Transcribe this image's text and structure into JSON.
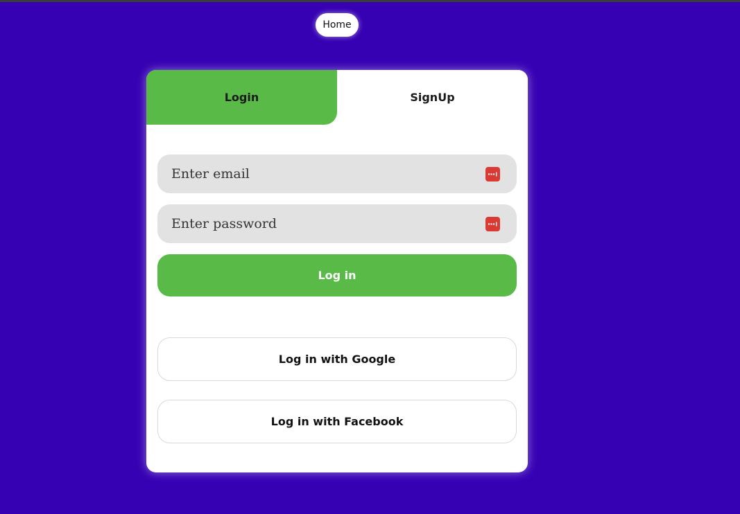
{
  "nav": {
    "home_label": "Home"
  },
  "tabs": {
    "login_label": "Login",
    "signup_label": "SignUp",
    "active": "Login"
  },
  "form": {
    "email": {
      "placeholder": "Enter email",
      "value": ""
    },
    "password": {
      "placeholder": "Enter password",
      "value": ""
    },
    "field_icon": "password-manager-icon",
    "login_button_label": "Log in"
  },
  "social": {
    "google_label": "Log in with Google",
    "facebook_label": "Log in with Facebook"
  },
  "colors": {
    "background": "#3600b3",
    "accent_green": "#5aba47",
    "field_bg": "#e2e2e2",
    "icon_red": "#d93a33",
    "card_bg": "#ffffff"
  }
}
